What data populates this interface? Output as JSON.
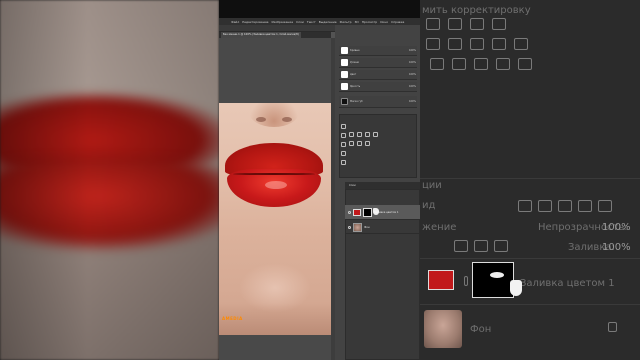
{
  "colors": {
    "lip_red": "#c8191a",
    "fill_swatch": "#c1191b",
    "ps_bg": "#535353",
    "watermark": "#ff8a00"
  },
  "background_right": {
    "top_text": "мить корректировку",
    "opacity_label": "Непрозрачность:",
    "opacity_value": "100%",
    "fill_label": "Заливка:",
    "fill_value": "100%",
    "mode_fragment": "жение",
    "fill_layer_name": "Заливка цветом 1",
    "bg_layer_name": "Фон",
    "tab_fragment": "ид",
    "tab_fragment2": "ции"
  },
  "photoshop": {
    "menu": [
      "Файл",
      "Редактирование",
      "Изображение",
      "Слои",
      "Текст",
      "Выделение",
      "Фильтр",
      "3D",
      "Просмотр",
      "Окно",
      "Справка"
    ],
    "doc_tab": "Без имени-1 @ 100% (Заливка цветом 1, Слой-маска/8)",
    "adjustments": [
      {
        "label": "Кривые",
        "value": "100%"
      },
      {
        "label": "Уровни",
        "value": "100%"
      },
      {
        "label": "Цвет",
        "value": "100%"
      },
      {
        "label": "Яркость",
        "value": "100%"
      },
      {
        "label": "Маска губ",
        "value": "100%"
      }
    ],
    "layers_title": "Слои",
    "layers": [
      {
        "name": "Заливка цветом 1",
        "selected": true
      },
      {
        "name": "Фон",
        "selected": false
      }
    ],
    "watermark": "AMEDIA"
  }
}
